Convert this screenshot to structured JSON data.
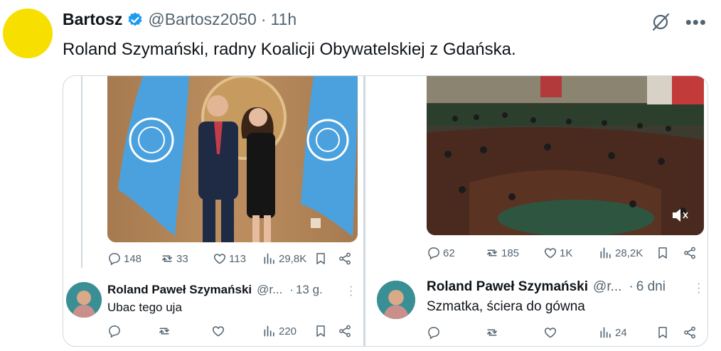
{
  "tweet": {
    "author_name": "Bartosz",
    "author_handle": "@Bartosz2050",
    "separator": "·",
    "time": "11h",
    "text": "Roland Szymański, radny Koalicji Obywatelskiej z Gdańska.",
    "avatar_color": "#f7df00",
    "verified_color": "#1d9bf0"
  },
  "top_icons": [
    "grok-icon",
    "more-icon"
  ],
  "colors": {
    "text": "#0f1419",
    "muted": "#536471",
    "border": "#cfd9de"
  },
  "screenshots": [
    {
      "image": "photo-two-people-un-flags",
      "stats": {
        "replies": "148",
        "reposts": "33",
        "likes": "113",
        "views": "29,8K"
      },
      "reply": {
        "name": "Roland Paweł Szymański",
        "handle": "@r...",
        "separator": "·",
        "time": "13 g.",
        "text": "Ubac tego uja",
        "views": "220"
      }
    },
    {
      "image": "video-parliament-chamber",
      "stats": {
        "replies": "62",
        "reposts": "185",
        "likes": "1K",
        "views": "28,2K"
      },
      "reply": {
        "name": "Roland Paweł Szymański",
        "handle": "@r...",
        "separator": "·",
        "time": "6 dni",
        "text": "Szmatka, ściera do gówna",
        "views": "24"
      }
    }
  ]
}
